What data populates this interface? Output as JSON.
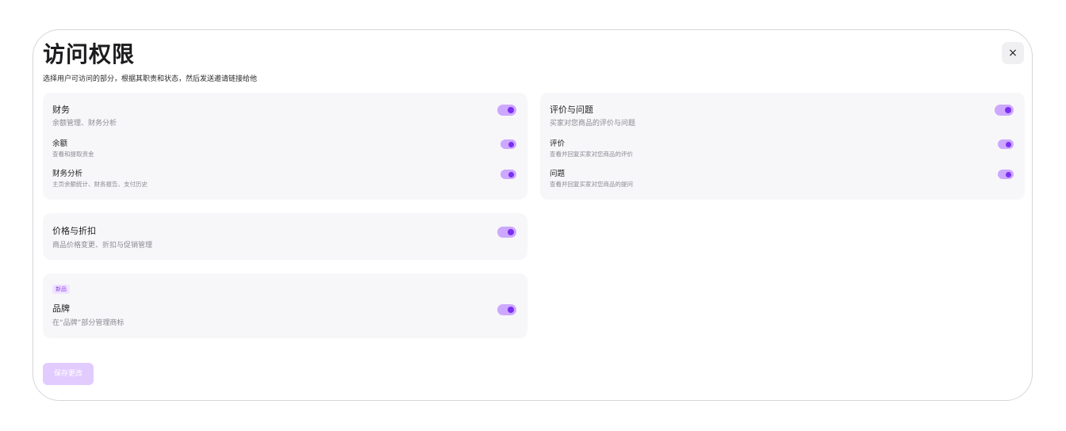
{
  "dialog": {
    "title": "访问权限",
    "subtitle": "选择用户可访问的部分，根据其职责和状态，然后发送邀请链接给他",
    "close_label": "×",
    "save_label": "保存更改"
  },
  "finance": {
    "title": "财务",
    "desc": "余额管理、财务分析",
    "enabled": true,
    "items": [
      {
        "label": "余额",
        "desc": "查看和提取资金",
        "enabled": true
      },
      {
        "label": "财务分析",
        "desc": "主页余额统计、财务报告、支付历史",
        "enabled": true
      }
    ]
  },
  "reviews": {
    "title": "评价与问题",
    "desc": "买家对您商品的评价与问题",
    "enabled": true,
    "items": [
      {
        "label": "评价",
        "desc": "查看并回复买家对您商品的评价",
        "enabled": true
      },
      {
        "label": "问题",
        "desc": "查看并回复买家对您商品的提问",
        "enabled": true
      }
    ]
  },
  "pricing": {
    "title": "价格与折扣",
    "desc": "商品价格变更、折扣与促销管理",
    "enabled": true
  },
  "brand": {
    "badge": "新品",
    "title": "品牌",
    "desc": "在“品牌”部分管理商标",
    "enabled": true
  },
  "colors": {
    "accent": "#7b2ff0",
    "toggle_track": "#cda8ff",
    "card_bg": "#f7f7f9",
    "save_disabled": "#e2cbff"
  }
}
